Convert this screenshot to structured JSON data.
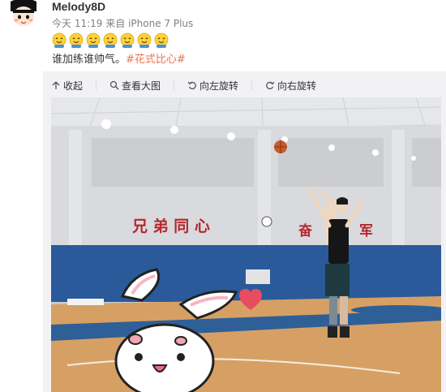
{
  "post": {
    "username": "Melody8D",
    "time": "今天 11:19",
    "source_prefix": "来自",
    "source": "iPhone 7 Plus",
    "emoji_count": 7,
    "emoji_name": "smile-emoji-icon",
    "text": "谁加练谁帅气。",
    "hashtag": "#花式比心#"
  },
  "toolbar": {
    "collapse_label": "收起",
    "view_large_label": "查看大图",
    "rotate_left_label": "向左旋转",
    "rotate_right_label": "向右旋转"
  },
  "photo": {
    "banner_left": "兄 弟 同 心",
    "banner_right": "奋",
    "banner_right2": "军"
  },
  "colors": {
    "hashtag": "#eb7350",
    "toolbar_bg": "#f2f2f5",
    "wall_blue": "#2a5a9a",
    "court_floor": "#d6a064"
  }
}
